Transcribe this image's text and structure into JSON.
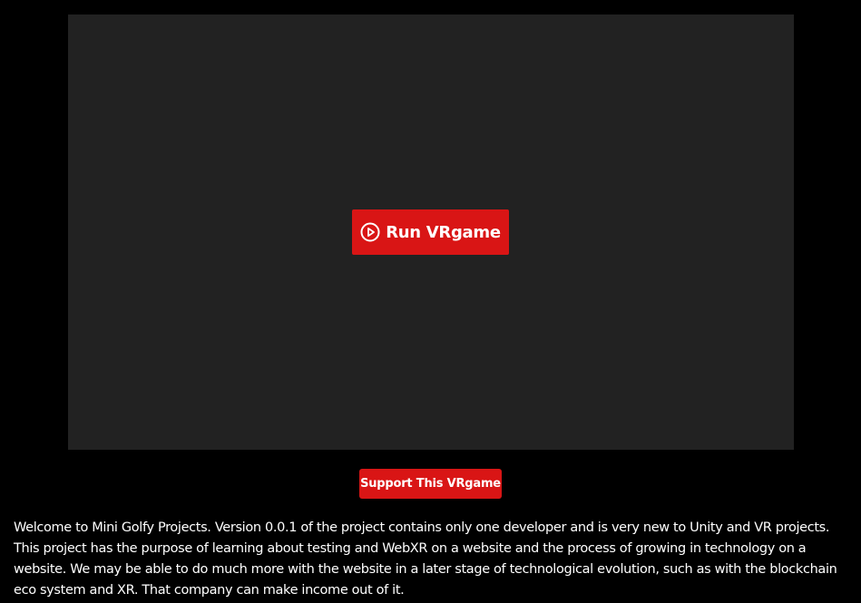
{
  "game": {
    "run_button_label": "Run VRgame",
    "run_icon": "play-circle-icon"
  },
  "support": {
    "button_label": "Support This VRgame"
  },
  "description": {
    "text": "Welcome to Mini Golfy Projects. Version 0.0.1 of the project contains only one developer and is very new to Unity and VR projects. This project has the purpose of learning about testing and WebXR on a website and the process of growing in technology on a website. We may be able to do much more with the website in a later stage of technological evolution, such as with the blockchain eco system and XR. That company can make income out of it."
  },
  "colors": {
    "background": "#000000",
    "game_frame": "#222222",
    "accent": "#d91515",
    "text": "#ffffff"
  }
}
